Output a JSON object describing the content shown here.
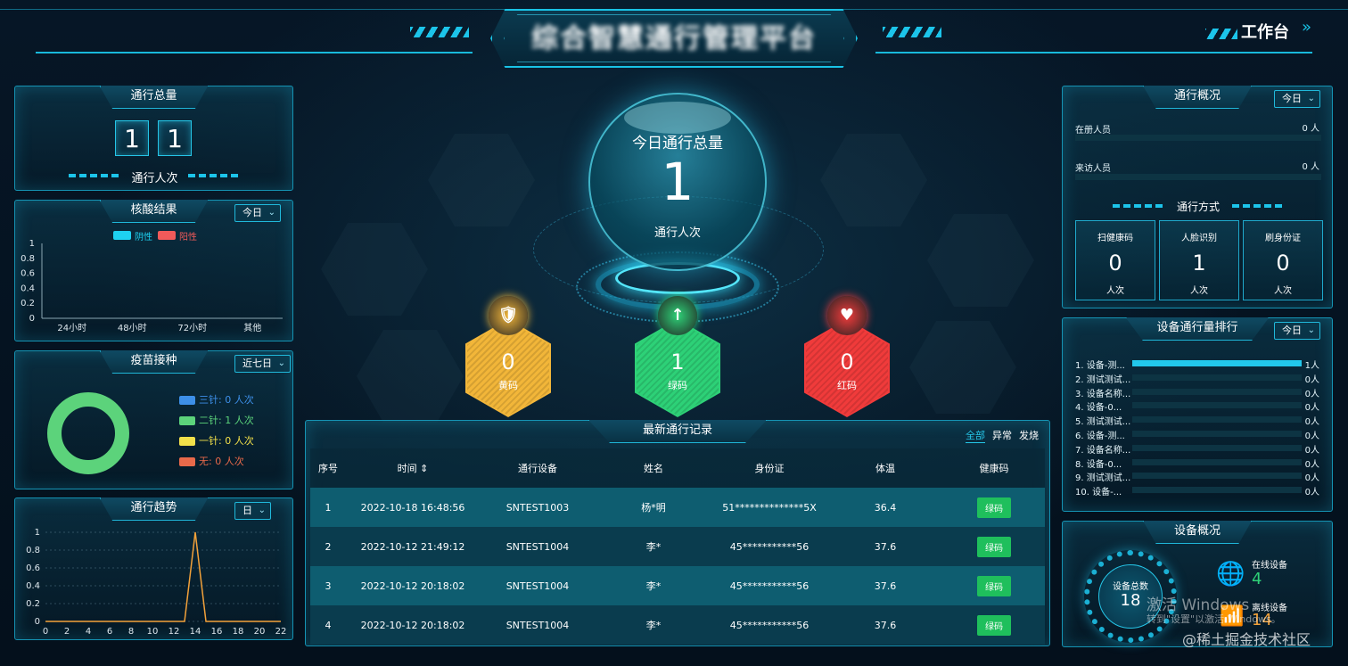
{
  "header": {
    "title": "综合智慧通行管理平台",
    "workbench": "工作台"
  },
  "traffic_total": {
    "title": "通行总量",
    "digits": [
      "1",
      "1"
    ],
    "caption": "通行人次"
  },
  "nucleic": {
    "title": "核酸结果",
    "range": "今日",
    "legend": [
      {
        "name": "阴性",
        "color": "#1ed1f1"
      },
      {
        "name": "阳性",
        "color": "#f15a5a"
      }
    ],
    "chart_data": {
      "type": "bar",
      "categories": [
        "24小时",
        "48小时",
        "72小时",
        "其他"
      ],
      "series": [
        {
          "name": "阴性",
          "values": [
            0,
            0,
            0,
            0
          ]
        },
        {
          "name": "阳性",
          "values": [
            0,
            0,
            0,
            0
          ]
        }
      ],
      "yticks": [
        "1",
        "0.8",
        "0.6",
        "0.4",
        "0.2",
        "0"
      ],
      "ylim": [
        0,
        1
      ]
    }
  },
  "vaccine": {
    "title": "疫苗接种",
    "range": "近七日",
    "items": [
      {
        "label": "三针: 0 人次",
        "color": "#3d8fe8"
      },
      {
        "label": "二针: 1 人次",
        "color": "#5cd37b"
      },
      {
        "label": "一针: 0 人次",
        "color": "#f2e04a"
      },
      {
        "label": "无: 0 人次",
        "color": "#e8694a"
      }
    ],
    "chart_data": {
      "type": "pie",
      "categories": [
        "三针",
        "二针",
        "一针",
        "无"
      ],
      "values": [
        0,
        1,
        0,
        0
      ]
    }
  },
  "trend": {
    "title": "通行趋势",
    "range": "日",
    "chart_data": {
      "type": "line",
      "x": [
        0,
        2,
        4,
        6,
        8,
        10,
        12,
        13,
        14,
        15,
        16,
        18,
        20,
        22
      ],
      "y": [
        0,
        0,
        0,
        0,
        0,
        0,
        0,
        0,
        1,
        0,
        0,
        0,
        0,
        0
      ],
      "xticks": [
        "0",
        "2",
        "4",
        "6",
        "8",
        "10",
        "12",
        "14",
        "16",
        "18",
        "20",
        "22"
      ],
      "yticks": [
        "1",
        "0.8",
        "0.6",
        "0.4",
        "0.2",
        "0"
      ],
      "ylim": [
        0,
        1
      ]
    }
  },
  "center": {
    "title": "今日通行总量",
    "value": "1",
    "caption": "通行人次",
    "codes": [
      {
        "value": "0",
        "label": "黄码",
        "color": "#f2b63a",
        "glyph": "🛡"
      },
      {
        "value": "1",
        "label": "绿码",
        "color": "#2ed177",
        "glyph": "↑"
      },
      {
        "value": "0",
        "label": "红码",
        "color": "#f13b3b",
        "glyph": "♥"
      }
    ]
  },
  "records": {
    "title": "最新通行记录",
    "filters": [
      "全部",
      "异常",
      "发烧"
    ],
    "headers": [
      "序号",
      "时间",
      "通行设备",
      "姓名",
      "身份证",
      "体温",
      "健康码"
    ],
    "sort_glyph": "⇕",
    "rows": [
      {
        "no": "1",
        "time": "2022-10-18 16:48:56",
        "device": "SNTEST1003",
        "name": "杨*明",
        "id": "51**************5X",
        "temp": "36.4",
        "code": "绿码"
      },
      {
        "no": "2",
        "time": "2022-10-12 21:49:12",
        "device": "SNTEST1004",
        "name": "李*",
        "id": "45***********56",
        "temp": "37.6",
        "code": "绿码"
      },
      {
        "no": "3",
        "time": "2022-10-12 20:18:02",
        "device": "SNTEST1004",
        "name": "李*",
        "id": "45***********56",
        "temp": "37.6",
        "code": "绿码"
      },
      {
        "no": "4",
        "time": "2022-10-12 20:18:02",
        "device": "SNTEST1004",
        "name": "李*",
        "id": "45***********56",
        "temp": "37.6",
        "code": "绿码"
      }
    ]
  },
  "overview": {
    "title": "通行概况",
    "range": "今日",
    "rows": [
      {
        "label": "在册人员",
        "value": "0 人"
      },
      {
        "label": "来访人员",
        "value": "0 人"
      }
    ],
    "mode_title": "通行方式",
    "modes": [
      {
        "label": "扫健康码",
        "value": "0",
        "unit": "人次"
      },
      {
        "label": "人脸识别",
        "value": "1",
        "unit": "人次"
      },
      {
        "label": "刷身份证",
        "value": "0",
        "unit": "人次"
      }
    ]
  },
  "ranking": {
    "title": "设备通行量排行",
    "range": "今日",
    "items": [
      {
        "label": "1. 设备-测...",
        "value": "1人",
        "fraction": 1
      },
      {
        "label": "2. 测试测试...",
        "value": "0人",
        "fraction": 0
      },
      {
        "label": "3. 设备名称...",
        "value": "0人",
        "fraction": 0
      },
      {
        "label": "4. 设备-0...",
        "value": "0人",
        "fraction": 0
      },
      {
        "label": "5. 测试测试...",
        "value": "0人",
        "fraction": 0
      },
      {
        "label": "6. 设备-测...",
        "value": "0人",
        "fraction": 0
      },
      {
        "label": "7. 设备名称...",
        "value": "0人",
        "fraction": 0
      },
      {
        "label": "8. 设备-0...",
        "value": "0人",
        "fraction": 0
      },
      {
        "label": "9. 测试测试...",
        "value": "0人",
        "fraction": 0
      },
      {
        "label": "10. 设备-...",
        "value": "0人",
        "fraction": 0
      }
    ]
  },
  "devices": {
    "title": "设备概况",
    "total_label": "设备总数",
    "total": "18",
    "online_label": "在线设备",
    "online": "4",
    "offline_label": "离线设备",
    "offline": "14"
  },
  "watermarks": {
    "windows_line1": "激活 Windows",
    "windows_line2": "转到\"设置\"以激活 Windows。",
    "site": "@稀土掘金技术社区"
  }
}
